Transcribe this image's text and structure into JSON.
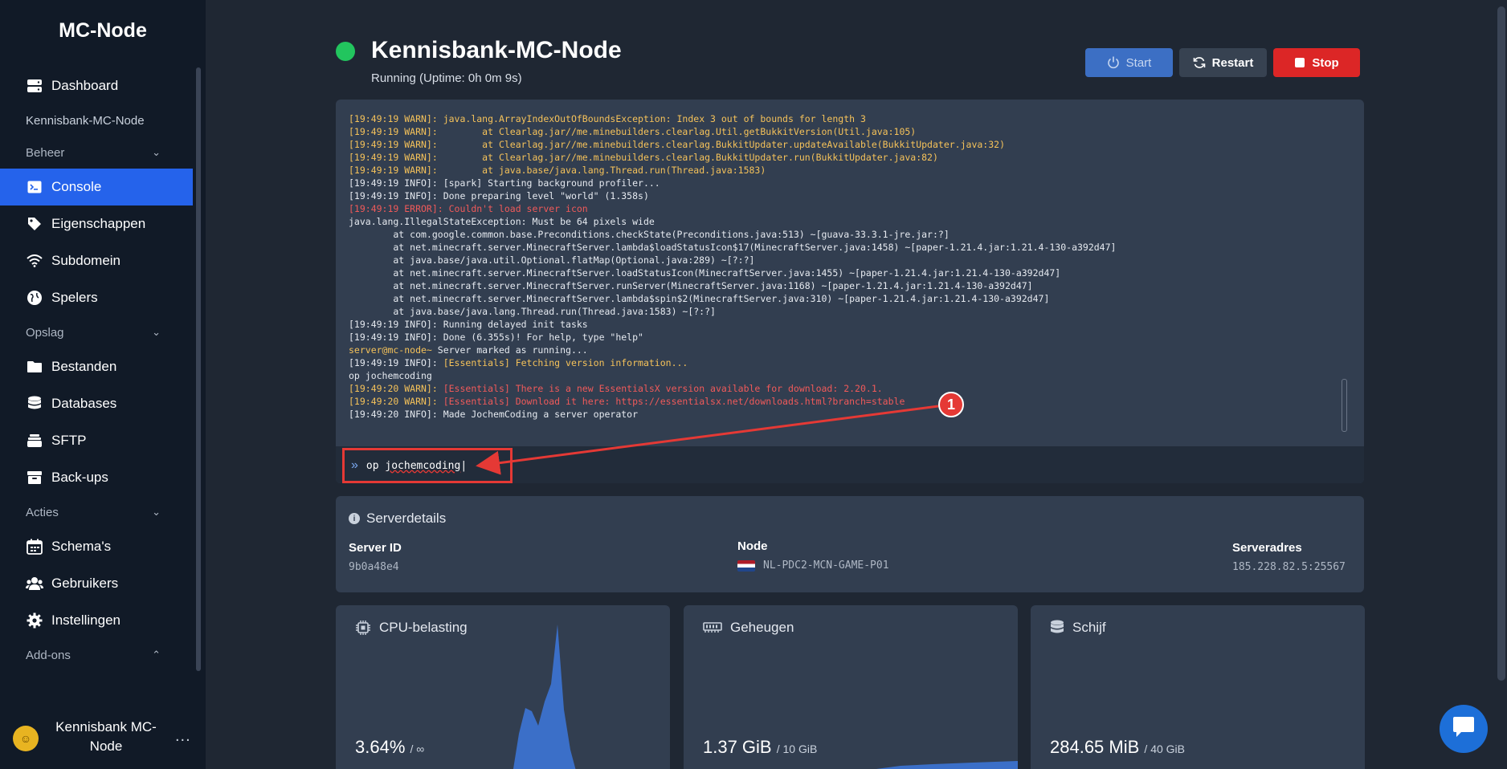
{
  "sidebar": {
    "brand": "MC-Node",
    "dashboard": "Dashboard",
    "server_name": "Kennisbank-MC-Node",
    "sections": {
      "beheer": "Beheer",
      "opslag": "Opslag",
      "acties": "Acties",
      "addons": "Add-ons"
    },
    "items": {
      "console": "Console",
      "eigenschappen": "Eigenschappen",
      "subdomein": "Subdomein",
      "spelers": "Spelers",
      "bestanden": "Bestanden",
      "databases": "Databases",
      "sftp": "SFTP",
      "backups": "Back-ups",
      "schemas": "Schema's",
      "gebruikers": "Gebruikers",
      "instellingen": "Instellingen"
    },
    "user": {
      "name": "Kennisbank MC-Node",
      "more": "..."
    }
  },
  "header": {
    "title": "Kennisbank-MC-Node",
    "status": "Running (Uptime: 0h 0m 9s)",
    "status_color": "#22c55e",
    "start_label": "Start",
    "restart_label": "Restart",
    "stop_label": "Stop"
  },
  "console": {
    "lines": [
      {
        "ts": "[19:49:19 WARN]:",
        "text": " java.lang.ArrayIndexOutOfBoundsException: Index 3 out of bounds for length 3",
        "level": "warn"
      },
      {
        "ts": "[19:49:19 WARN]:",
        "text": "        at Clearlag.jar//me.minebuilders.clearlag.Util.getBukkitVersion(Util.java:105)",
        "level": "warn"
      },
      {
        "ts": "[19:49:19 WARN]:",
        "text": "        at Clearlag.jar//me.minebuilders.clearlag.BukkitUpdater.updateAvailable(BukkitUpdater.java:32)",
        "level": "warn"
      },
      {
        "ts": "[19:49:19 WARN]:",
        "text": "        at Clearlag.jar//me.minebuilders.clearlag.BukkitUpdater.run(BukkitUpdater.java:82)",
        "level": "warn"
      },
      {
        "ts": "[19:49:19 WARN]:",
        "text": "        at java.base/java.lang.Thread.run(Thread.java:1583)",
        "level": "warn"
      },
      {
        "ts": "[19:49:19 INFO]:",
        "text": " [spark] Starting background profiler...",
        "level": "info"
      },
      {
        "ts": "[19:49:19 INFO]:",
        "text": " Done preparing level \"world\" (1.358s)",
        "level": "info"
      },
      {
        "ts": "[19:49:19 ERROR]:",
        "text": " Couldn't load server icon",
        "level": "error"
      },
      {
        "ts": "",
        "text": "java.lang.IllegalStateException: Must be 64 pixels wide",
        "level": "plain"
      },
      {
        "ts": "",
        "text": "        at com.google.common.base.Preconditions.checkState(Preconditions.java:513) ~[guava-33.3.1-jre.jar:?]",
        "level": "plain"
      },
      {
        "ts": "",
        "text": "        at net.minecraft.server.MinecraftServer.lambda$loadStatusIcon$17(MinecraftServer.java:1458) ~[paper-1.21.4.jar:1.21.4-130-a392d47]",
        "level": "plain"
      },
      {
        "ts": "",
        "text": "        at java.base/java.util.Optional.flatMap(Optional.java:289) ~[?:?]",
        "level": "plain"
      },
      {
        "ts": "",
        "text": "        at net.minecraft.server.MinecraftServer.loadStatusIcon(MinecraftServer.java:1455) ~[paper-1.21.4.jar:1.21.4-130-a392d47]",
        "level": "plain"
      },
      {
        "ts": "",
        "text": "        at net.minecraft.server.MinecraftServer.runServer(MinecraftServer.java:1168) ~[paper-1.21.4.jar:1.21.4-130-a392d47]",
        "level": "plain"
      },
      {
        "ts": "",
        "text": "        at net.minecraft.server.MinecraftServer.lambda$spin$2(MinecraftServer.java:310) ~[paper-1.21.4.jar:1.21.4-130-a392d47]",
        "level": "plain"
      },
      {
        "ts": "",
        "text": "        at java.base/java.lang.Thread.run(Thread.java:1583) ~[?:?]",
        "level": "plain"
      },
      {
        "ts": "[19:49:19 INFO]:",
        "text": " Running delayed init tasks",
        "level": "info"
      },
      {
        "ts": "[19:49:19 INFO]:",
        "text": " Done (6.355s)! For help, type \"help\"",
        "level": "info"
      },
      {
        "ts": "server@mc-node~",
        "text": " Server marked as running...",
        "level": "prompt"
      },
      {
        "ts": "[19:49:19 INFO]:",
        "text": " [Essentials] Fetching version information...",
        "level": "info-ess"
      },
      {
        "ts": "",
        "text": "op jochemcoding",
        "level": "plain"
      },
      {
        "ts": "[19:49:20 WARN]:",
        "text": " [Essentials] There is a new EssentialsX version available for download: 2.20.1.",
        "level": "warn-ess"
      },
      {
        "ts": "[19:49:20 WARN]:",
        "text": " [Essentials] Download it here: https://essentialsx.net/downloads.html?branch=stable",
        "level": "warn-ess"
      },
      {
        "ts": "[19:49:20 INFO]:",
        "text": " Made JochemCoding a server operator",
        "level": "info"
      }
    ],
    "input_prefix": "op ",
    "input_value_word": "jochemcoding",
    "annotation_number": "1"
  },
  "details": {
    "heading": "Serverdetails",
    "server_id_label": "Server ID",
    "server_id": "9b0a48e4",
    "node_label": "Node",
    "node": "NL-PDC2-MCN-GAME-P01",
    "address_label": "Serveradres",
    "address": "185.228.82.5:25567"
  },
  "stats": {
    "cpu": {
      "title": "CPU-belasting",
      "value": "3.64%",
      "limit": "/ ∞"
    },
    "memory": {
      "title": "Geheugen",
      "value": "1.37 GiB",
      "limit": "/ 10 GiB"
    },
    "disk": {
      "title": "Schijf",
      "value": "284.65 MiB",
      "limit": "/ 40 GiB"
    }
  },
  "colors": {
    "accent": "#2563eb",
    "stop": "#dc2626",
    "warn": "#f5c25a",
    "error": "#f05a5a",
    "graph": "#3b6fc8"
  }
}
